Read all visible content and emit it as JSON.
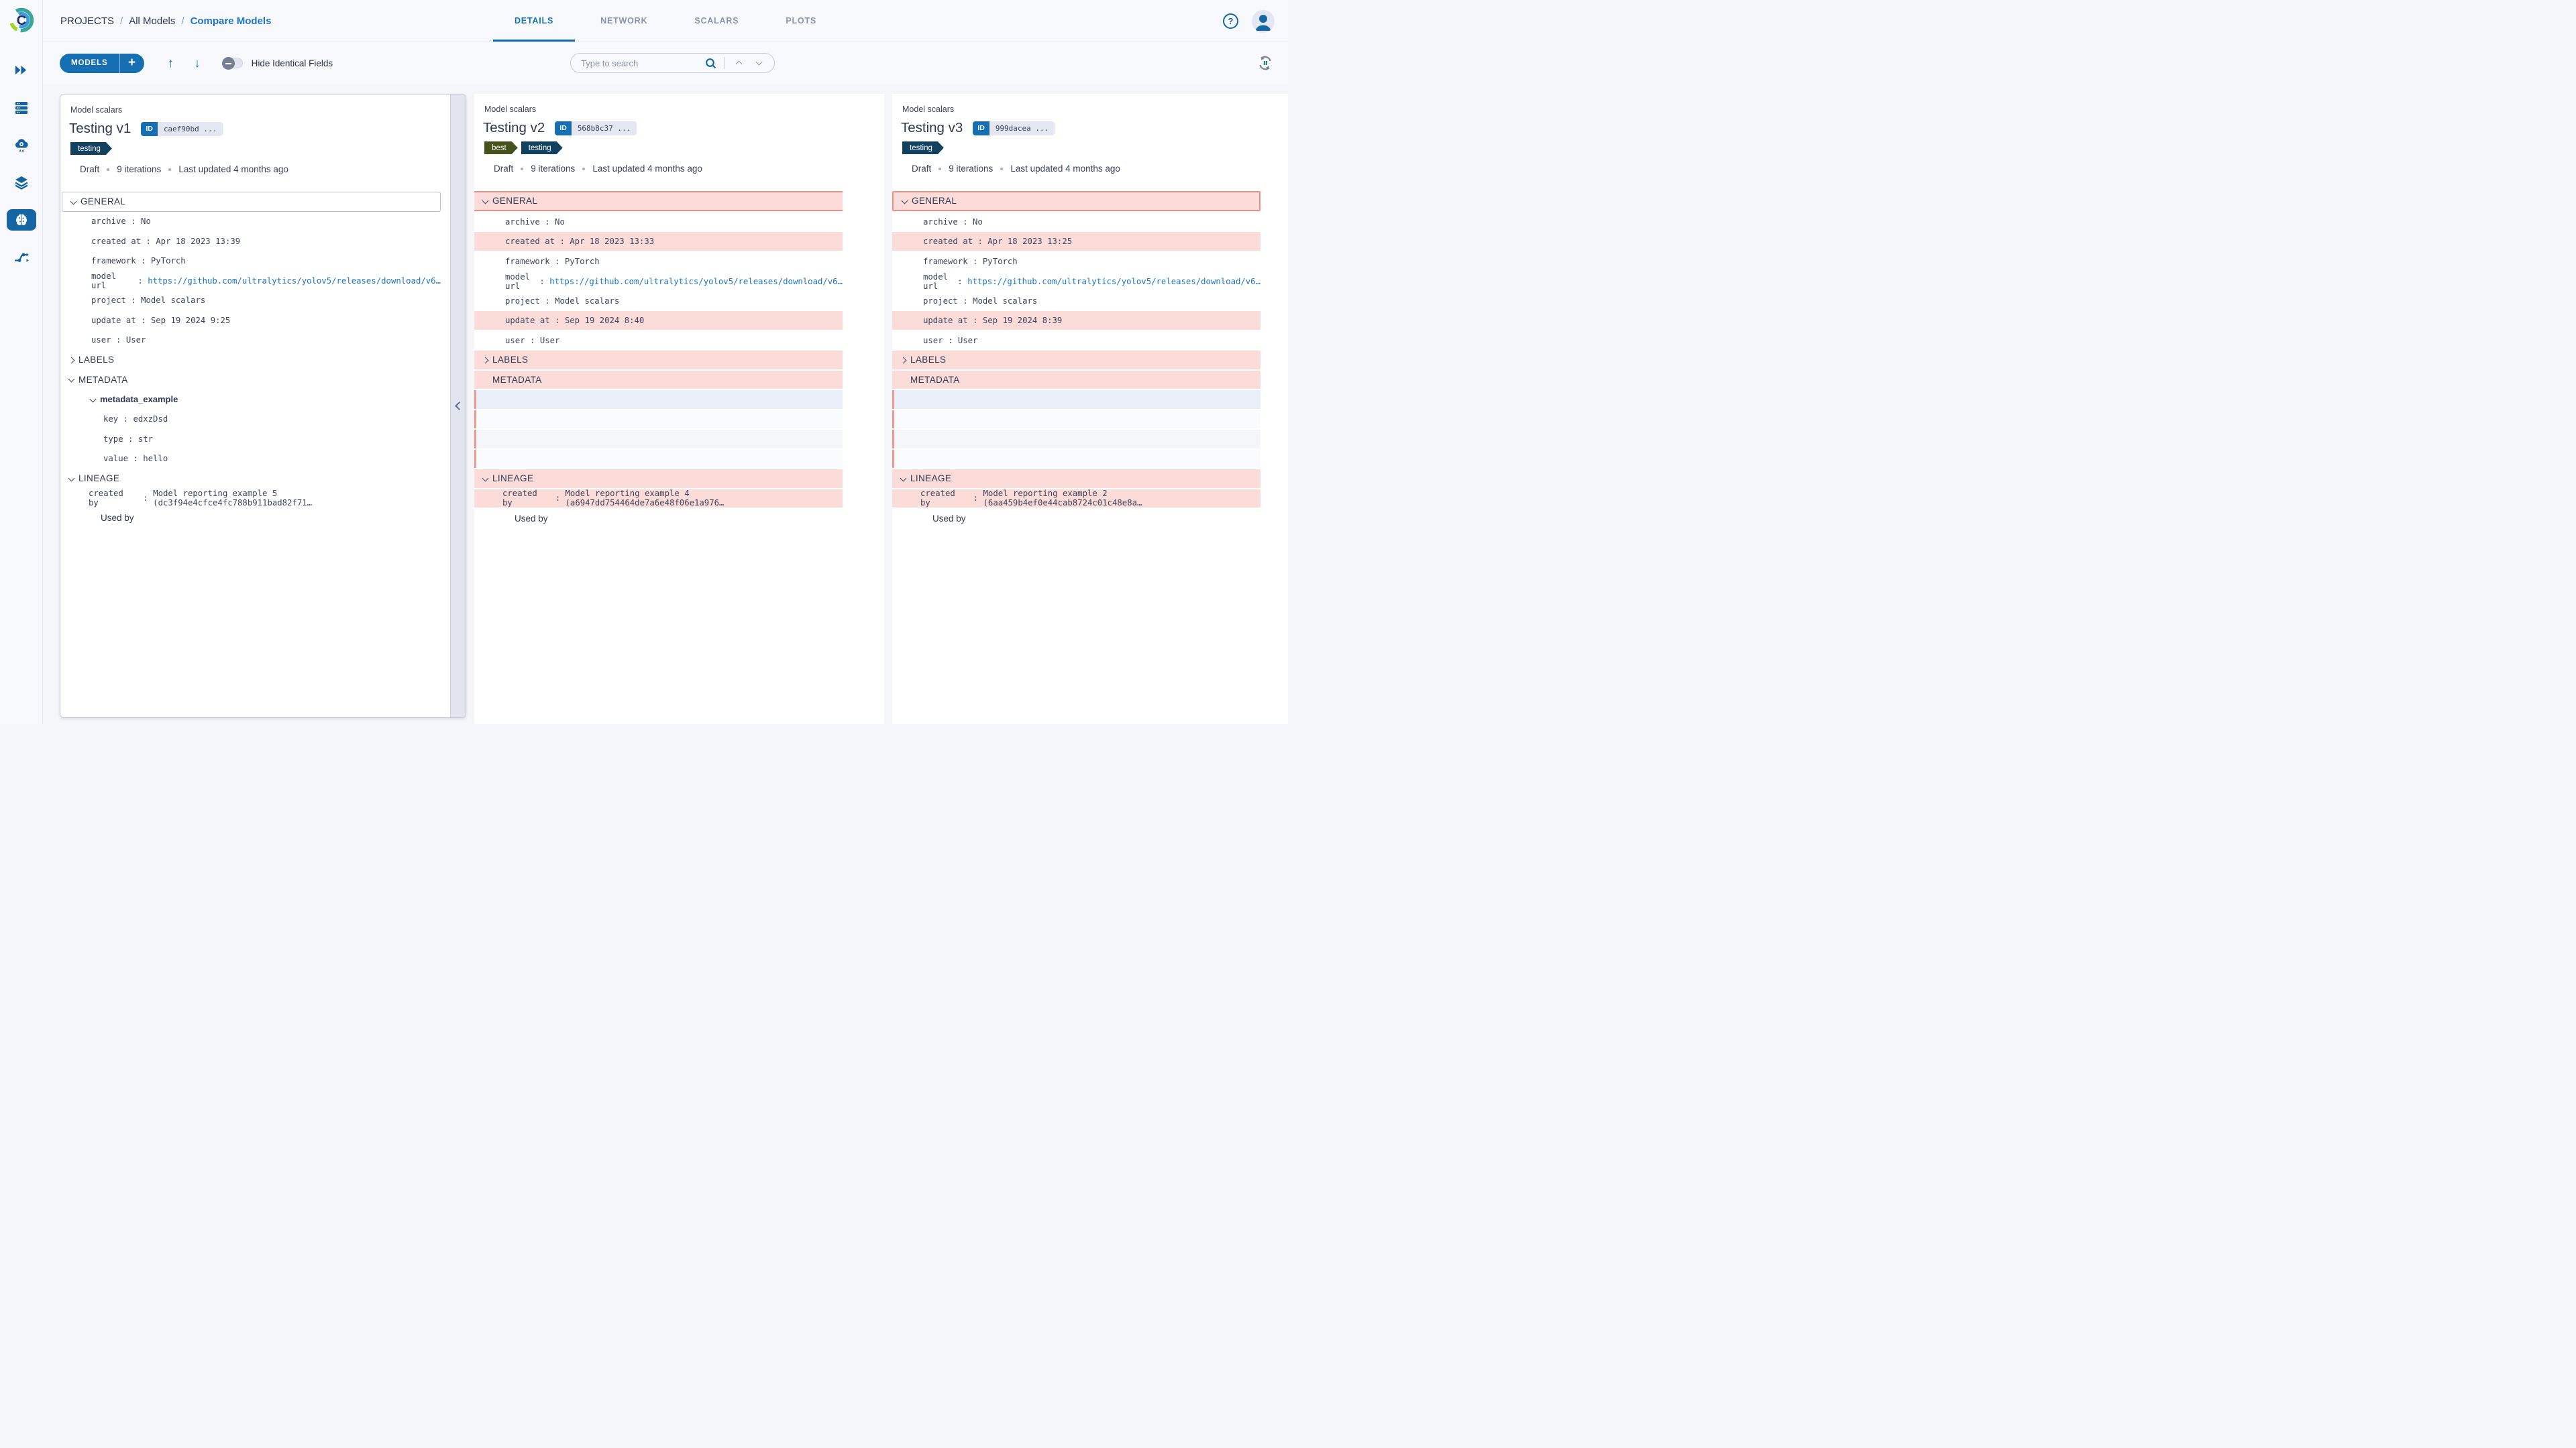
{
  "app": {
    "breadcrumb": [
      "PROJECTS",
      "All Models",
      "Compare Models"
    ],
    "breadcrumb_separator": "/",
    "tabs": [
      {
        "label": "DETAILS",
        "active": true
      },
      {
        "label": "NETWORK",
        "active": false
      },
      {
        "label": "SCALARS",
        "active": false
      },
      {
        "label": "PLOTS",
        "active": false
      }
    ],
    "help_glyph": "?"
  },
  "sidebar": {
    "items": [
      {
        "name": "fast-forward-icon",
        "active": false
      },
      {
        "name": "queues-icon",
        "active": false
      },
      {
        "name": "cloud-gear-icon",
        "active": false
      },
      {
        "name": "datasets-icon",
        "active": false
      },
      {
        "name": "models-icon",
        "active": true
      },
      {
        "name": "pipelines-icon",
        "active": false
      }
    ]
  },
  "toolbar": {
    "models_label": "MODELS",
    "add_label": "+",
    "up_arrow": "↑",
    "down_arrow": "↓",
    "hide_identical_label": "Hide Identical Fields",
    "hide_identical_on": false,
    "search": {
      "placeholder": "Type to search"
    }
  },
  "colors": {
    "accent_blue": "#156fb2",
    "link_blue": "#1d74c6",
    "breadcrumb_blue": "#2274c8",
    "diff_row_bg": "#fcdcd9",
    "diff_border": "#ef9087",
    "tag_testing": "#12405f",
    "tag_best": "#45521c",
    "empty_stripe_blue": "#eaeffa",
    "empty_stripe_light": "#fafbfd"
  },
  "collapse_button_glyph": "‹",
  "cards": [
    {
      "project_label": "Model scalars",
      "title": "Testing v1",
      "id_label": "ID",
      "id_value": "caef90bd ...",
      "tags": [
        {
          "label": "testing",
          "color": "#12405f"
        }
      ],
      "status": [
        "Draft",
        "9 iterations",
        "Last updated 4 months ago"
      ],
      "rows": [
        {
          "kind": "section",
          "label": "GENERAL",
          "chevron": "down",
          "boxed": true
        },
        {
          "kind": "field",
          "label": "archive",
          "value": "No"
        },
        {
          "kind": "field",
          "label": "created at",
          "value": "Apr 18 2023 13:39"
        },
        {
          "kind": "field",
          "label": "framework",
          "value": "PyTorch"
        },
        {
          "kind": "field",
          "label": "model url",
          "value": "https://github.com/ultralytics/yolov5/releases/download/v6…",
          "link": true
        },
        {
          "kind": "field",
          "label": "project",
          "value": "Model scalars"
        },
        {
          "kind": "field",
          "label": "update at",
          "value": "Sep 19 2024 9:25"
        },
        {
          "kind": "field",
          "label": "user",
          "value": "User"
        },
        {
          "kind": "section",
          "label": "LABELS",
          "chevron": "right"
        },
        {
          "kind": "section",
          "label": "METADATA",
          "chevron": "down"
        },
        {
          "kind": "group",
          "label": "metadata_example",
          "chevron": "down"
        },
        {
          "kind": "subfield",
          "label": "key",
          "value": "edxzDsd"
        },
        {
          "kind": "subfield",
          "label": "type",
          "value": "str"
        },
        {
          "kind": "subfield",
          "label": "value",
          "value": "hello"
        },
        {
          "kind": "section",
          "label": "LINEAGE",
          "chevron": "down"
        },
        {
          "kind": "lineage",
          "label": "created by",
          "value": "Model reporting example 5 (dc3f94e4cfce4fc788b911bad82f71…"
        },
        {
          "kind": "text",
          "label": "Used by"
        }
      ]
    },
    {
      "project_label": "Model scalars",
      "title": "Testing v2",
      "id_label": "ID",
      "id_value": "568b8c37 ...",
      "tags": [
        {
          "label": "best",
          "color": "#45521c"
        },
        {
          "label": "testing",
          "color": "#12405f"
        }
      ],
      "status": [
        "Draft",
        "9 iterations",
        "Last updated 4 months ago"
      ],
      "rows": [
        {
          "kind": "section",
          "label": "GENERAL",
          "chevron": "down",
          "diff": true,
          "frame": "tb"
        },
        {
          "kind": "field",
          "label": "archive",
          "value": "No"
        },
        {
          "kind": "field",
          "label": "created at",
          "value": "Apr 18 2023 13:33",
          "diff": true
        },
        {
          "kind": "field",
          "label": "framework",
          "value": "PyTorch"
        },
        {
          "kind": "field",
          "label": "model url",
          "value": "https://github.com/ultralytics/yolov5/releases/download/v6…",
          "link": true
        },
        {
          "kind": "field",
          "label": "project",
          "value": "Model scalars"
        },
        {
          "kind": "field",
          "label": "update at",
          "value": "Sep 19 2024 8:40",
          "diff": true
        },
        {
          "kind": "field",
          "label": "user",
          "value": "User"
        },
        {
          "kind": "section",
          "label": "LABELS",
          "chevron": "right",
          "diff": true
        },
        {
          "kind": "section",
          "label": "METADATA",
          "chevron": "none",
          "diff": true
        },
        {
          "kind": "empty",
          "bg": "#eaeffa"
        },
        {
          "kind": "empty",
          "bg": "#fafbfd"
        },
        {
          "kind": "empty",
          "bg": "#f4f6fa"
        },
        {
          "kind": "empty",
          "bg": "#fafbfd"
        },
        {
          "kind": "section",
          "label": "LINEAGE",
          "chevron": "down",
          "diff": true
        },
        {
          "kind": "lineage",
          "label": "created by",
          "value": "Model reporting example 4 (a6947dd754464de7a6e48f06e1a976…",
          "diff": true
        },
        {
          "kind": "text",
          "label": "Used by"
        }
      ]
    },
    {
      "project_label": "Model scalars",
      "title": "Testing v3",
      "id_label": "ID",
      "id_value": "999dacea ...",
      "tags": [
        {
          "label": "testing",
          "color": "#12405f"
        }
      ],
      "status": [
        "Draft",
        "9 iterations",
        "Last updated 4 months ago"
      ],
      "rows": [
        {
          "kind": "section",
          "label": "GENERAL",
          "chevron": "down",
          "diff": true,
          "frame": "full"
        },
        {
          "kind": "field",
          "label": "archive",
          "value": "No"
        },
        {
          "kind": "field",
          "label": "created at",
          "value": "Apr 18 2023 13:25",
          "diff": true
        },
        {
          "kind": "field",
          "label": "framework",
          "value": "PyTorch"
        },
        {
          "kind": "field",
          "label": "model url",
          "value": "https://github.com/ultralytics/yolov5/releases/download/v6…",
          "link": true
        },
        {
          "kind": "field",
          "label": "project",
          "value": "Model scalars"
        },
        {
          "kind": "field",
          "label": "update at",
          "value": "Sep 19 2024 8:39",
          "diff": true
        },
        {
          "kind": "field",
          "label": "user",
          "value": "User"
        },
        {
          "kind": "section",
          "label": "LABELS",
          "chevron": "right",
          "diff": true
        },
        {
          "kind": "section",
          "label": "METADATA",
          "chevron": "none",
          "diff": true
        },
        {
          "kind": "empty",
          "bg": "#eaeffa"
        },
        {
          "kind": "empty",
          "bg": "#fafbfd"
        },
        {
          "kind": "empty",
          "bg": "#f4f6fa"
        },
        {
          "kind": "empty",
          "bg": "#fafbfd"
        },
        {
          "kind": "section",
          "label": "LINEAGE",
          "chevron": "down",
          "diff": true
        },
        {
          "kind": "lineage",
          "label": "created by",
          "value": "Model reporting example 2 (6aa459b4ef0e44cab8724c01c48e8a…",
          "diff": true
        },
        {
          "kind": "text",
          "label": "Used by"
        }
      ]
    }
  ]
}
